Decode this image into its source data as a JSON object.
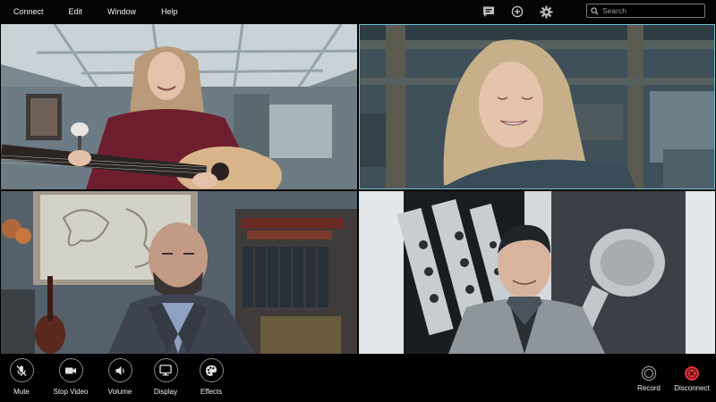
{
  "menu": {
    "items": [
      "Connect",
      "Edit",
      "Window",
      "Help"
    ]
  },
  "top_icons": [
    "chat-icon",
    "add-circle-icon",
    "gear-icon"
  ],
  "search": {
    "placeholder": "Search",
    "value": ""
  },
  "participants": [
    {
      "position": "top-left",
      "active_speaker": false
    },
    {
      "position": "top-right",
      "active_speaker": true
    },
    {
      "position": "bottom-left",
      "active_speaker": false
    },
    {
      "position": "bottom-right",
      "active_speaker": false
    }
  ],
  "toolbar": {
    "mute": "Mute",
    "stop_video": "Stop Video",
    "volume": "Volume",
    "display": "Display",
    "effects": "Effects",
    "record": "Record",
    "disconnect": "Disconnect"
  },
  "colors": {
    "background": "#000000",
    "active_speaker_border": "#79c2d4",
    "disconnect": "#e0333a",
    "button_ring": "#8a8a8a"
  }
}
